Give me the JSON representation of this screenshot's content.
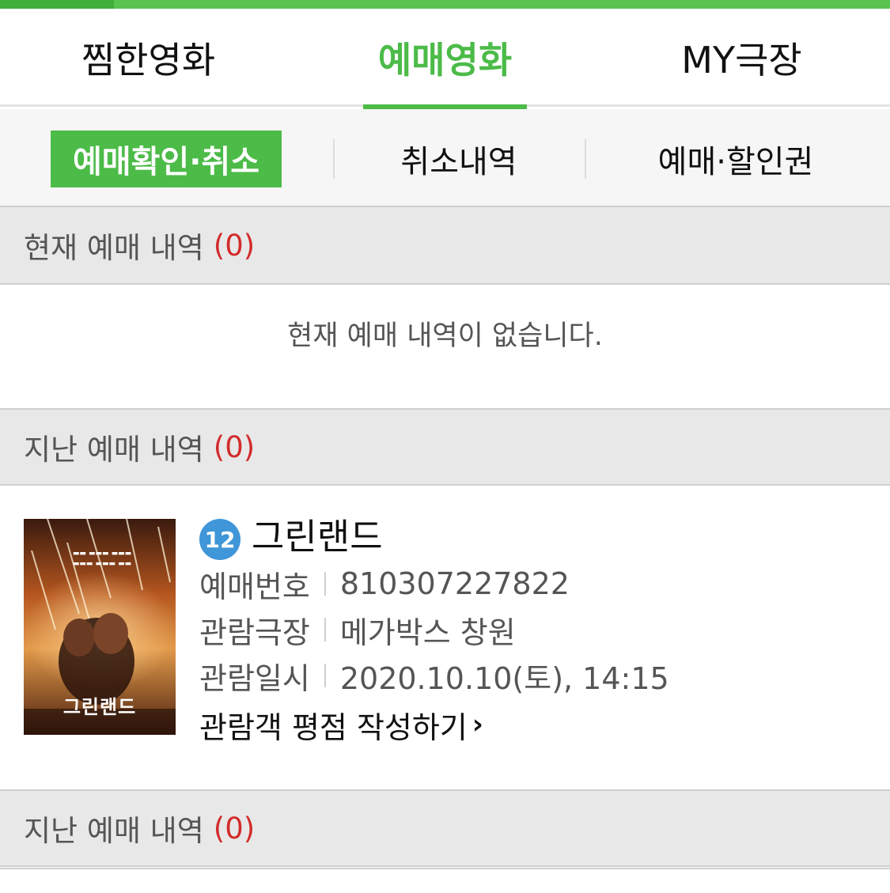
{
  "main_tabs": [
    {
      "label": "찜한영화"
    },
    {
      "label": "예매영화"
    },
    {
      "label": "MY극장"
    }
  ],
  "sub_tabs": [
    {
      "label": "예매확인·취소"
    },
    {
      "label": "취소내역"
    },
    {
      "label": "예매·할인권"
    }
  ],
  "current_section": {
    "title": "현재 예매 내역",
    "count": "(0)",
    "empty_message": "현재 예매 내역이 없습니다."
  },
  "past_section": {
    "title": "지난 예매 내역",
    "count": "(0)"
  },
  "booking": {
    "rating": "12",
    "title": "그린랜드",
    "poster_title": "그린랜드",
    "reservation_label": "예매번호",
    "reservation_number": "810307227822",
    "theater_label": "관람극장",
    "theater": "메가박스 창원",
    "datetime_label": "관람일시",
    "datetime": "2020.10.10(토), 14:15",
    "review_link": "관람객 평점 작성하기"
  },
  "past_section_2": {
    "title": "지난 예매 내역",
    "count": "(0)"
  },
  "colors": {
    "accent": "#4cbb48",
    "count_red": "#d32b2b",
    "rating_blue": "#3f96d8"
  },
  "icons": {
    "review_chevron": "chevron-right-icon"
  }
}
